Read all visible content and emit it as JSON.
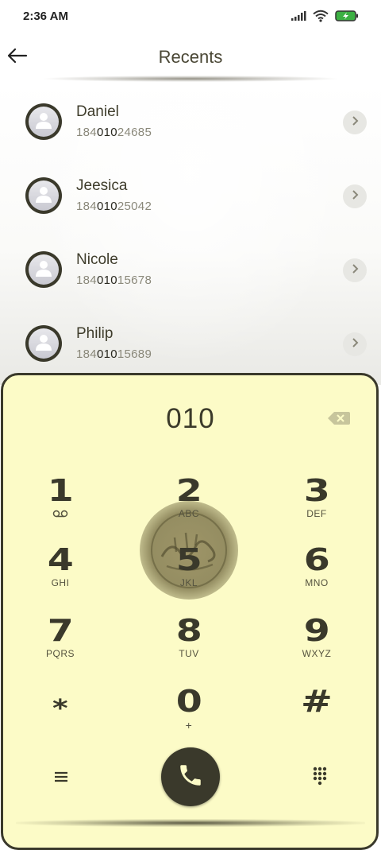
{
  "status_bar": {
    "time": "2:36 AM",
    "icons": [
      "signal-icon",
      "wifi-icon",
      "battery-charging-icon"
    ]
  },
  "header": {
    "title": "Recents",
    "back_icon": "arrow-left-icon"
  },
  "contacts": [
    {
      "name": "Daniel",
      "number_pre": "184",
      "number_match": "010",
      "number_post": "24685"
    },
    {
      "name": "Jeesica",
      "number_pre": "184",
      "number_match": "010",
      "number_post": "25042"
    },
    {
      "name": "Nicole",
      "number_pre": "184",
      "number_match": "010",
      "number_post": "15678"
    },
    {
      "name": "Philip",
      "number_pre": "184",
      "number_match": "010",
      "number_post": "15689"
    }
  ],
  "dialer": {
    "input": "010",
    "keys": [
      {
        "digit": "1",
        "letters": ""
      },
      {
        "digit": "2",
        "letters": "ABC"
      },
      {
        "digit": "3",
        "letters": "DEF"
      },
      {
        "digit": "4",
        "letters": "GHI"
      },
      {
        "digit": "5",
        "letters": "JKL"
      },
      {
        "digit": "6",
        "letters": "MNO"
      },
      {
        "digit": "7",
        "letters": "PQRS"
      },
      {
        "digit": "8",
        "letters": "TUV"
      },
      {
        "digit": "9",
        "letters": "WXYZ"
      },
      {
        "digit": "*",
        "letters": ""
      },
      {
        "digit": "0",
        "letters": "+"
      },
      {
        "digit": "#",
        "letters": ""
      }
    ],
    "voicemail_icon": "voicemail-icon",
    "bottom": {
      "menu_icon": "menu-icon",
      "call_icon": "phone-icon",
      "dialpad_icon": "dialpad-icon"
    }
  },
  "colors": {
    "accent": "#3a392b",
    "dialpad_bg": "#fcfbc7",
    "text": "#3b3a2a"
  }
}
